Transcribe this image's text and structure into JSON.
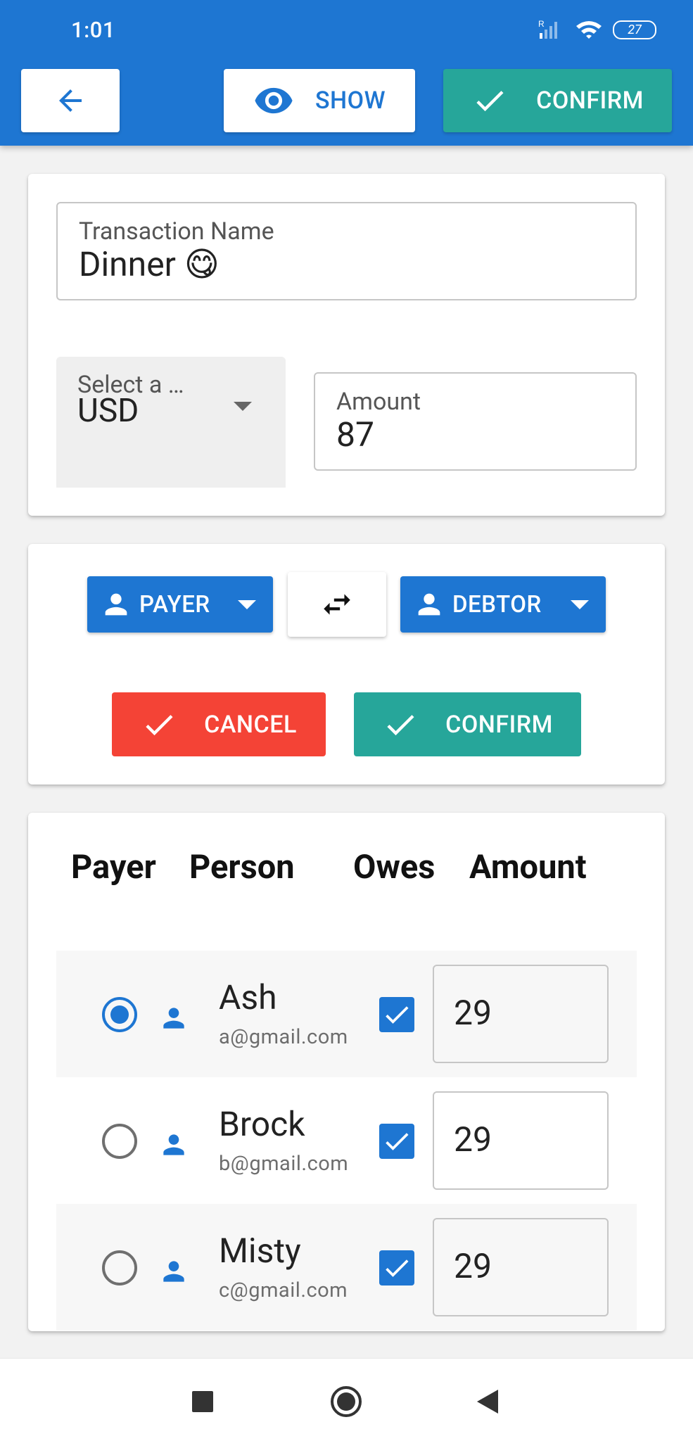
{
  "status_bar": {
    "time": "1:01",
    "battery": "27",
    "icons": [
      "signal-icon",
      "wifi-icon",
      "battery-icon"
    ]
  },
  "toolbar": {
    "back_icon": "arrow-back-icon",
    "show_label": "SHOW",
    "confirm_label": "CONFIRM",
    "colors": {
      "bar": "#1e76d2",
      "confirm": "#26a69a"
    }
  },
  "transaction": {
    "name_label": "Transaction Name",
    "name_value": "Dinner 😋",
    "currency_label": "Select a …",
    "currency_value": "USD",
    "amount_label": "Amount",
    "amount_value": "87"
  },
  "actions": {
    "payer_label": "PAYER",
    "debtor_label": "DEBTOR",
    "swap_icon": "swap-icon",
    "cancel_label": "CANCEL",
    "confirm_label": "CONFIRM",
    "colors": {
      "cancel": "#f44336",
      "confirm": "#26a69a"
    }
  },
  "table": {
    "headers": {
      "payer": "Payer",
      "person": "Person",
      "owes": "Owes",
      "amount": "Amount"
    },
    "rows": [
      {
        "name": "Ash",
        "email": "a@gmail.com",
        "is_payer": true,
        "owes": true,
        "amount": "29"
      },
      {
        "name": "Brock",
        "email": "b@gmail.com",
        "is_payer": false,
        "owes": true,
        "amount": "29"
      },
      {
        "name": "Misty",
        "email": "c@gmail.com",
        "is_payer": false,
        "owes": true,
        "amount": "29"
      }
    ]
  },
  "navbar": {
    "icons": [
      "recents-icon",
      "home-icon",
      "back-icon"
    ]
  }
}
